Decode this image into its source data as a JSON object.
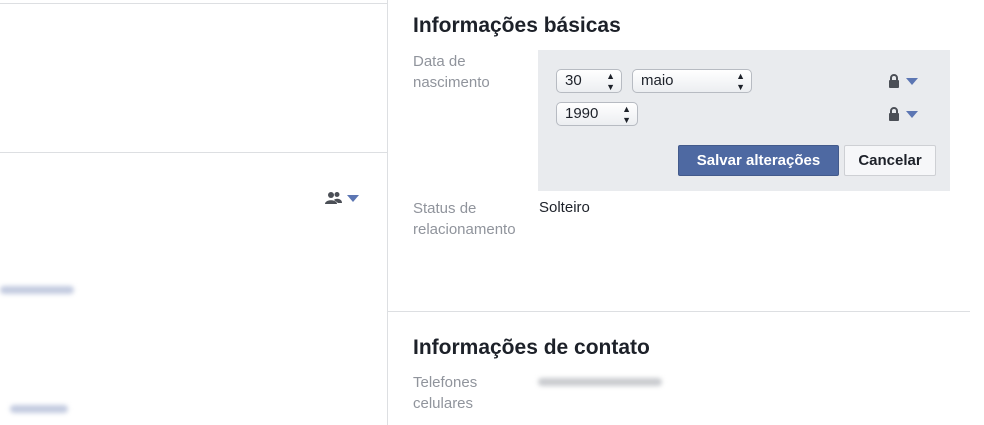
{
  "left_panel": {
    "audience_icon": "people-icon",
    "blurred_link_1": "",
    "blurred_link_2": ""
  },
  "basic_info": {
    "title": "Informações básicas",
    "birth_label": "Data de nascimento",
    "day_value": "30",
    "month_value": "maio",
    "year_value": "1990",
    "privacy_icon": "lock-icon",
    "save_label": "Salvar alterações",
    "cancel_label": "Cancelar",
    "relationship_label": "Status de relacionamento",
    "relationship_value": "Solteiro"
  },
  "contact_info": {
    "title": "Informações de contato",
    "phones_label": "Telefones celulares",
    "phones_value": ""
  },
  "colors": {
    "accent": "#4e69a2",
    "caret": "#5c76b3",
    "label_gray": "#90949c",
    "panel_bg": "#e9ebee"
  }
}
